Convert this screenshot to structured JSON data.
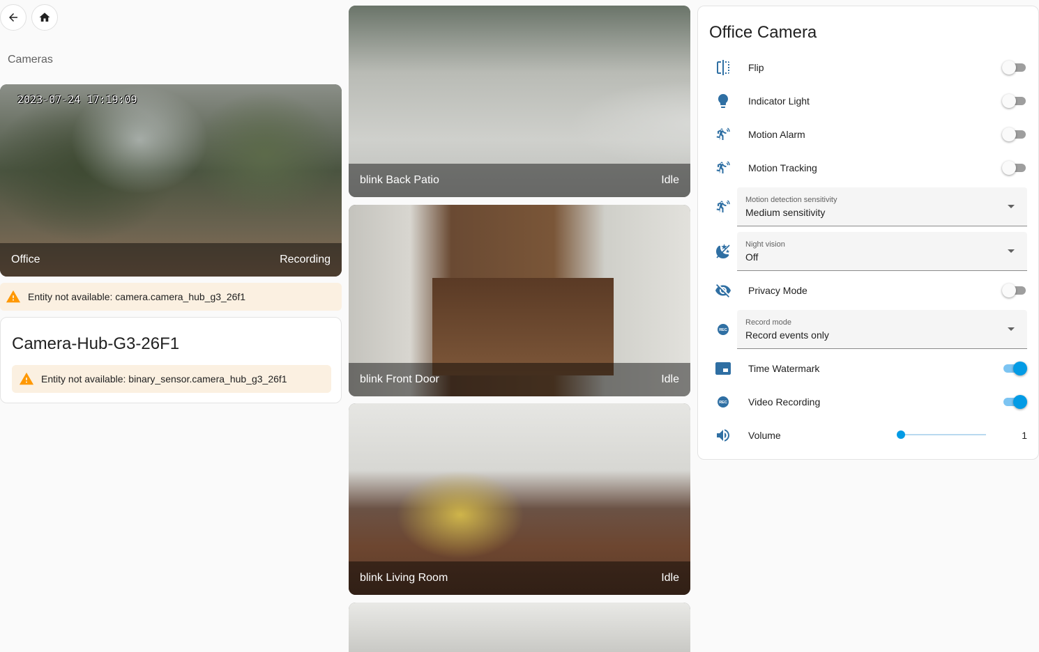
{
  "nav": {
    "back_icon": "arrow-left-icon",
    "home_icon": "home-icon"
  },
  "section_title": "Cameras",
  "office_camera_card": {
    "timestamp": "2023-07-24 17:19:09",
    "name": "Office",
    "state": "Recording"
  },
  "office_warning": "Entity not available: camera.camera_hub_g3_26f1",
  "hub_card": {
    "title": "Camera-Hub-G3-26F1",
    "warning": "Entity not available: binary_sensor.camera_hub_g3_26f1"
  },
  "blink_cameras": [
    {
      "name": "blink Back Patio",
      "state": "Idle"
    },
    {
      "name": "blink Front Door",
      "state": "Idle"
    },
    {
      "name": "blink Living Room",
      "state": "Idle"
    }
  ],
  "entities_card": {
    "title": "Office Camera",
    "flip": {
      "label": "Flip",
      "on": false,
      "icon": "flip-horizontal-icon"
    },
    "indicator_light": {
      "label": "Indicator Light",
      "on": false,
      "icon": "lightbulb-icon"
    },
    "motion_alarm": {
      "label": "Motion Alarm",
      "on": false,
      "icon": "motion-sensor-icon"
    },
    "motion_tracking": {
      "label": "Motion Tracking",
      "on": false,
      "icon": "motion-sensor-icon"
    },
    "motion_sensitivity": {
      "label": "Motion detection sensitivity",
      "value": "Medium sensitivity",
      "icon": "motion-sensor-icon"
    },
    "night_vision": {
      "label": "Night vision",
      "value": "Off",
      "icon": "weather-night-icon"
    },
    "privacy_mode": {
      "label": "Privacy Mode",
      "on": false,
      "icon": "eye-off-icon"
    },
    "record_mode": {
      "label": "Record mode",
      "value": "Record events only",
      "icon": "record-rec-icon"
    },
    "time_watermark": {
      "label": "Time Watermark",
      "on": true,
      "icon": "picture-in-picture-icon"
    },
    "video_recording": {
      "label": "Video Recording",
      "on": true,
      "icon": "record-rec-icon"
    },
    "volume": {
      "label": "Volume",
      "value": "1",
      "level": 0,
      "icon": "volume-high-icon"
    }
  },
  "colors": {
    "accent": "#039be5",
    "icon": "#2f6fa3",
    "warning_bg": "#fbf0e1",
    "warning_icon": "#ff9800"
  }
}
